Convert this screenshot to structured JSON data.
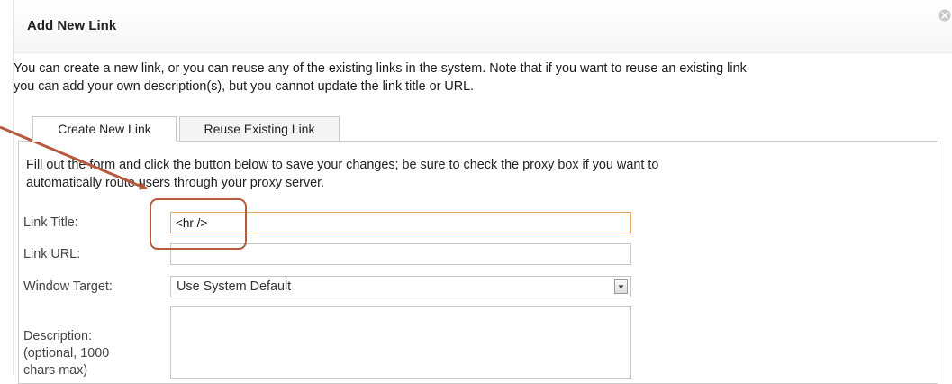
{
  "dialog": {
    "title": "Add New Link",
    "intro_line1": "You can create a new link, or you can reuse any of the existing links in the system. Note that if you want to reuse an existing link",
    "intro_line2": "you can add your own description(s), but you cannot update the link title or URL."
  },
  "tabs": [
    {
      "label": "Create New Link",
      "active": true
    },
    {
      "label": "Reuse Existing Link",
      "active": false
    }
  ],
  "form": {
    "instructions_line1": "Fill out the form and click the button below to save your changes; be sure to check the proxy box if you want to",
    "instructions_line2": "automatically route users through your proxy server.",
    "link_title": {
      "label": "Link Title:",
      "value": "<hr />"
    },
    "link_url": {
      "label": "Link URL:",
      "value": ""
    },
    "window_target": {
      "label": "Window Target:",
      "selected": "Use System Default"
    },
    "description": {
      "label_line1": "Description:",
      "label_line2": "(optional, 1000",
      "label_line3": "chars max)",
      "value": ""
    }
  },
  "icons": {
    "close": "close-icon",
    "dropdown": "chevron-down-icon"
  },
  "colors": {
    "annotation": "#b5593f",
    "focus_border": "#e6a865"
  }
}
